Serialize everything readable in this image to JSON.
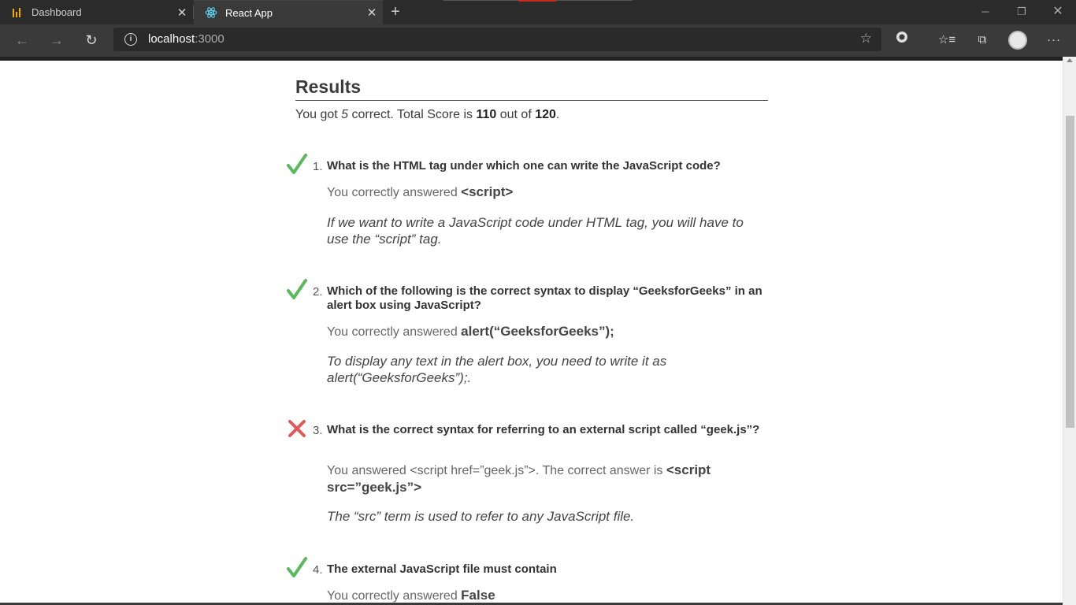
{
  "browser": {
    "tabs": [
      {
        "title": "Dashboard",
        "icon": "bar-chart-icon",
        "active": false
      },
      {
        "title": "React App",
        "icon": "react-icon",
        "active": true
      }
    ],
    "url_host": "localhost",
    "url_port": ":3000"
  },
  "results": {
    "title": "Results",
    "summary": {
      "prefix": "You got ",
      "correct": "5",
      "middle": " correct. Total Score is ",
      "score": "110",
      "out_of_text": " out of ",
      "total": "120",
      "suffix": "."
    },
    "questions": [
      {
        "num": "1.",
        "status": "correct",
        "text": "What is the HTML tag under which one can write the JavaScript code?",
        "answer_prefix": "You correctly answered ",
        "answer": "<script>",
        "explanation": "If we want to write a JavaScript code under HTML tag, you will have to use the “script” tag."
      },
      {
        "num": "2.",
        "status": "correct",
        "text": "Which of the following is the correct syntax to display “GeeksforGeeks” in an alert box using JavaScript?",
        "answer_prefix": "You correctly answered ",
        "answer": "alert(“GeeksforGeeks”);",
        "explanation": "To display any text in the alert box, you need to write it as alert(“GeeksforGeeks”);."
      },
      {
        "num": "3.",
        "status": "incorrect",
        "text": "What is the correct syntax for referring to an external script called “geek.js”?",
        "answer_prefix": "You answered <script href=”geek.js”>. The correct answer is ",
        "answer": "<script src=”geek.js”>",
        "explanation": "The “src” term is used to refer to any JavaScript file."
      },
      {
        "num": "4.",
        "status": "correct",
        "text": "The external JavaScript file must contain",
        "answer_prefix": "You correctly answered ",
        "answer": "False"
      }
    ]
  },
  "colors": {
    "correct": "#5cb85c",
    "incorrect": "#e05a5a",
    "chrome_dark": "#2b2b2b",
    "chrome_toolbar": "#3a3a3a"
  }
}
